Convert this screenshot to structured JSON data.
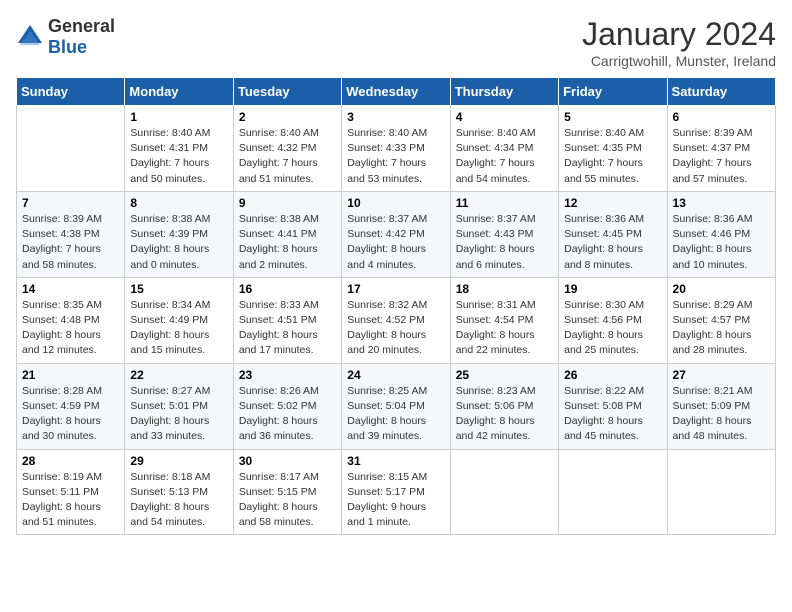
{
  "logo": {
    "general": "General",
    "blue": "Blue"
  },
  "header": {
    "month_title": "January 2024",
    "location": "Carrigtwohill, Munster, Ireland"
  },
  "weekdays": [
    "Sunday",
    "Monday",
    "Tuesday",
    "Wednesday",
    "Thursday",
    "Friday",
    "Saturday"
  ],
  "weeks": [
    [
      {
        "day": "",
        "sunrise": "",
        "sunset": "",
        "daylight": ""
      },
      {
        "day": "1",
        "sunrise": "Sunrise: 8:40 AM",
        "sunset": "Sunset: 4:31 PM",
        "daylight": "Daylight: 7 hours and 50 minutes."
      },
      {
        "day": "2",
        "sunrise": "Sunrise: 8:40 AM",
        "sunset": "Sunset: 4:32 PM",
        "daylight": "Daylight: 7 hours and 51 minutes."
      },
      {
        "day": "3",
        "sunrise": "Sunrise: 8:40 AM",
        "sunset": "Sunset: 4:33 PM",
        "daylight": "Daylight: 7 hours and 53 minutes."
      },
      {
        "day": "4",
        "sunrise": "Sunrise: 8:40 AM",
        "sunset": "Sunset: 4:34 PM",
        "daylight": "Daylight: 7 hours and 54 minutes."
      },
      {
        "day": "5",
        "sunrise": "Sunrise: 8:40 AM",
        "sunset": "Sunset: 4:35 PM",
        "daylight": "Daylight: 7 hours and 55 minutes."
      },
      {
        "day": "6",
        "sunrise": "Sunrise: 8:39 AM",
        "sunset": "Sunset: 4:37 PM",
        "daylight": "Daylight: 7 hours and 57 minutes."
      }
    ],
    [
      {
        "day": "7",
        "sunrise": "Sunrise: 8:39 AM",
        "sunset": "Sunset: 4:38 PM",
        "daylight": "Daylight: 7 hours and 58 minutes."
      },
      {
        "day": "8",
        "sunrise": "Sunrise: 8:38 AM",
        "sunset": "Sunset: 4:39 PM",
        "daylight": "Daylight: 8 hours and 0 minutes."
      },
      {
        "day": "9",
        "sunrise": "Sunrise: 8:38 AM",
        "sunset": "Sunset: 4:41 PM",
        "daylight": "Daylight: 8 hours and 2 minutes."
      },
      {
        "day": "10",
        "sunrise": "Sunrise: 8:37 AM",
        "sunset": "Sunset: 4:42 PM",
        "daylight": "Daylight: 8 hours and 4 minutes."
      },
      {
        "day": "11",
        "sunrise": "Sunrise: 8:37 AM",
        "sunset": "Sunset: 4:43 PM",
        "daylight": "Daylight: 8 hours and 6 minutes."
      },
      {
        "day": "12",
        "sunrise": "Sunrise: 8:36 AM",
        "sunset": "Sunset: 4:45 PM",
        "daylight": "Daylight: 8 hours and 8 minutes."
      },
      {
        "day": "13",
        "sunrise": "Sunrise: 8:36 AM",
        "sunset": "Sunset: 4:46 PM",
        "daylight": "Daylight: 8 hours and 10 minutes."
      }
    ],
    [
      {
        "day": "14",
        "sunrise": "Sunrise: 8:35 AM",
        "sunset": "Sunset: 4:48 PM",
        "daylight": "Daylight: 8 hours and 12 minutes."
      },
      {
        "day": "15",
        "sunrise": "Sunrise: 8:34 AM",
        "sunset": "Sunset: 4:49 PM",
        "daylight": "Daylight: 8 hours and 15 minutes."
      },
      {
        "day": "16",
        "sunrise": "Sunrise: 8:33 AM",
        "sunset": "Sunset: 4:51 PM",
        "daylight": "Daylight: 8 hours and 17 minutes."
      },
      {
        "day": "17",
        "sunrise": "Sunrise: 8:32 AM",
        "sunset": "Sunset: 4:52 PM",
        "daylight": "Daylight: 8 hours and 20 minutes."
      },
      {
        "day": "18",
        "sunrise": "Sunrise: 8:31 AM",
        "sunset": "Sunset: 4:54 PM",
        "daylight": "Daylight: 8 hours and 22 minutes."
      },
      {
        "day": "19",
        "sunrise": "Sunrise: 8:30 AM",
        "sunset": "Sunset: 4:56 PM",
        "daylight": "Daylight: 8 hours and 25 minutes."
      },
      {
        "day": "20",
        "sunrise": "Sunrise: 8:29 AM",
        "sunset": "Sunset: 4:57 PM",
        "daylight": "Daylight: 8 hours and 28 minutes."
      }
    ],
    [
      {
        "day": "21",
        "sunrise": "Sunrise: 8:28 AM",
        "sunset": "Sunset: 4:59 PM",
        "daylight": "Daylight: 8 hours and 30 minutes."
      },
      {
        "day": "22",
        "sunrise": "Sunrise: 8:27 AM",
        "sunset": "Sunset: 5:01 PM",
        "daylight": "Daylight: 8 hours and 33 minutes."
      },
      {
        "day": "23",
        "sunrise": "Sunrise: 8:26 AM",
        "sunset": "Sunset: 5:02 PM",
        "daylight": "Daylight: 8 hours and 36 minutes."
      },
      {
        "day": "24",
        "sunrise": "Sunrise: 8:25 AM",
        "sunset": "Sunset: 5:04 PM",
        "daylight": "Daylight: 8 hours and 39 minutes."
      },
      {
        "day": "25",
        "sunrise": "Sunrise: 8:23 AM",
        "sunset": "Sunset: 5:06 PM",
        "daylight": "Daylight: 8 hours and 42 minutes."
      },
      {
        "day": "26",
        "sunrise": "Sunrise: 8:22 AM",
        "sunset": "Sunset: 5:08 PM",
        "daylight": "Daylight: 8 hours and 45 minutes."
      },
      {
        "day": "27",
        "sunrise": "Sunrise: 8:21 AM",
        "sunset": "Sunset: 5:09 PM",
        "daylight": "Daylight: 8 hours and 48 minutes."
      }
    ],
    [
      {
        "day": "28",
        "sunrise": "Sunrise: 8:19 AM",
        "sunset": "Sunset: 5:11 PM",
        "daylight": "Daylight: 8 hours and 51 minutes."
      },
      {
        "day": "29",
        "sunrise": "Sunrise: 8:18 AM",
        "sunset": "Sunset: 5:13 PM",
        "daylight": "Daylight: 8 hours and 54 minutes."
      },
      {
        "day": "30",
        "sunrise": "Sunrise: 8:17 AM",
        "sunset": "Sunset: 5:15 PM",
        "daylight": "Daylight: 8 hours and 58 minutes."
      },
      {
        "day": "31",
        "sunrise": "Sunrise: 8:15 AM",
        "sunset": "Sunset: 5:17 PM",
        "daylight": "Daylight: 9 hours and 1 minute."
      },
      {
        "day": "",
        "sunrise": "",
        "sunset": "",
        "daylight": ""
      },
      {
        "day": "",
        "sunrise": "",
        "sunset": "",
        "daylight": ""
      },
      {
        "day": "",
        "sunrise": "",
        "sunset": "",
        "daylight": ""
      }
    ]
  ]
}
